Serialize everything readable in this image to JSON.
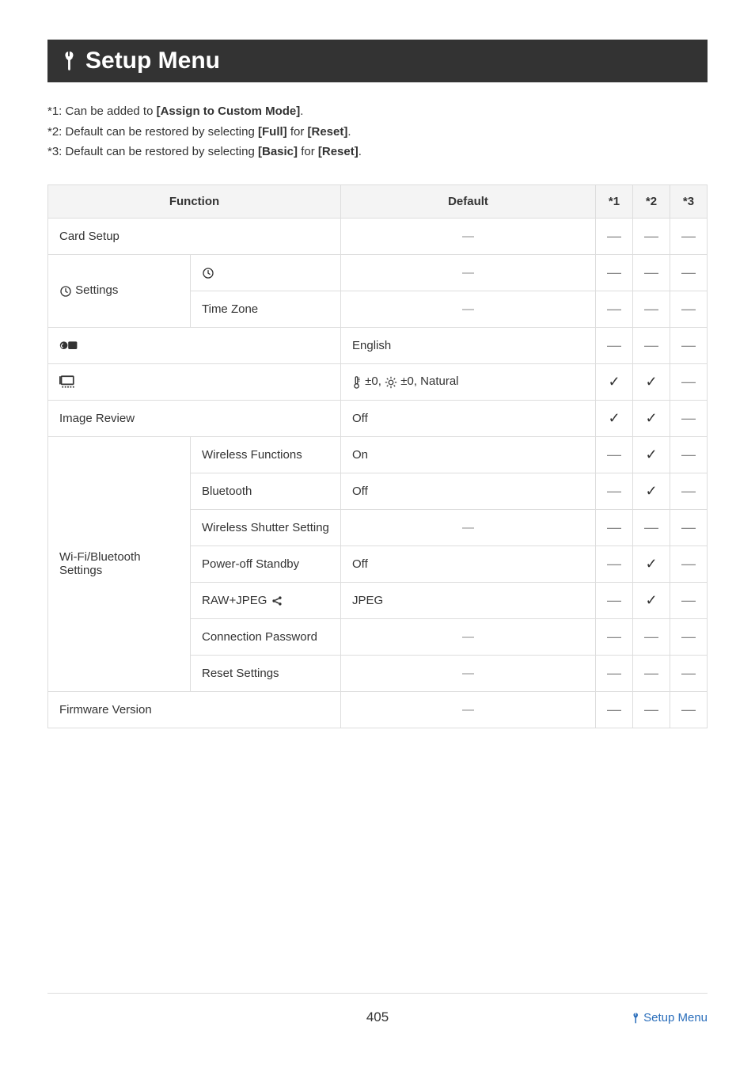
{
  "header": {
    "title": "Setup Menu"
  },
  "notes": {
    "n1_pre": "*1: Can be added to ",
    "n1_bold": "[Assign to Custom Mode]",
    "n1_post": ".",
    "n2_pre": "*2: Default can be restored by selecting ",
    "n2_bold1": "[Full]",
    "n2_mid": " for ",
    "n2_bold2": "[Reset]",
    "n2_post": ".",
    "n3_pre": "*3: Default can be restored by selecting ",
    "n3_bold1": "[Basic]",
    "n3_mid": " for ",
    "n3_bold2": "[Reset]",
    "n3_post": "."
  },
  "table": {
    "headers": {
      "function": "Function",
      "default": "Default",
      "c1": "*1",
      "c2": "*2",
      "c3": "*3"
    },
    "rows": {
      "card_setup": {
        "func": "Card Setup",
        "def": "—",
        "c1": "—",
        "c2": "—",
        "c3": "—"
      },
      "clock_settings": {
        "label": " Settings"
      },
      "clock_clock": {
        "def": "—",
        "c1": "—",
        "c2": "—",
        "c3": "—"
      },
      "clock_tz": {
        "sub": "Time Zone",
        "def": "—",
        "c1": "—",
        "c2": "—",
        "c3": "—"
      },
      "language": {
        "def": "English",
        "c1": "—",
        "c2": "—",
        "c3": "—"
      },
      "monitor": {
        "def_tail": " ±0, Natural",
        "def_pre": " ±0, ",
        "c1": "✓",
        "c2": "✓",
        "c3": "—"
      },
      "image_review": {
        "func": "Image Review",
        "def": "Off",
        "c1": "✓",
        "c2": "✓",
        "c3": "—"
      },
      "wifi_group": {
        "label": "Wi-Fi/Bluetooth Settings"
      },
      "wifi_wireless": {
        "sub": "Wireless Functions",
        "def": "On",
        "c1": "—",
        "c2": "✓",
        "c3": "—"
      },
      "wifi_bt": {
        "sub": "Bluetooth",
        "def": "Off",
        "c1": "—",
        "c2": "✓",
        "c3": "—"
      },
      "wifi_shutter": {
        "sub": "Wireless Shutter Setting",
        "def": "—",
        "c1": "—",
        "c2": "—",
        "c3": "—"
      },
      "wifi_standby": {
        "sub": "Power-off Standby",
        "def": "Off",
        "c1": "—",
        "c2": "✓",
        "c3": "—"
      },
      "wifi_rawjpeg": {
        "sub": "RAW+JPEG ",
        "def": "JPEG",
        "c1": "—",
        "c2": "✓",
        "c3": "—"
      },
      "wifi_pwd": {
        "sub": "Connection Password",
        "def": "—",
        "c1": "—",
        "c2": "—",
        "c3": "—"
      },
      "wifi_reset": {
        "sub": "Reset Settings",
        "def": "—",
        "c1": "—",
        "c2": "—",
        "c3": "—"
      },
      "firmware": {
        "func": "Firmware Version",
        "def": "—",
        "c1": "—",
        "c2": "—",
        "c3": "—"
      }
    }
  },
  "footer": {
    "page": "405",
    "crumb": "Setup Menu"
  }
}
